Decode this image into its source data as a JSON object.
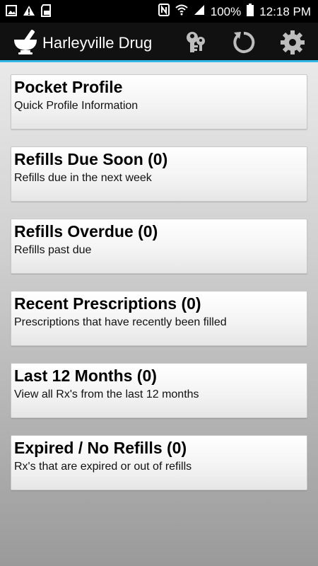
{
  "status_bar": {
    "left_icons": [
      "image-icon",
      "warning-icon",
      "sd-card-icon"
    ],
    "right_icons": [
      "nfc-icon",
      "wifi-icon",
      "signal-icon",
      "battery-icon"
    ],
    "battery": "100%",
    "time": "12:18 PM"
  },
  "app_bar": {
    "title": "Harleyville Drug",
    "logo_icon": "mortar-pestle-icon",
    "actions": [
      "unlock-keys-icon",
      "refresh-icon",
      "settings-gear-icon"
    ],
    "accent_color": "#33b5e5"
  },
  "cards": [
    {
      "title": "Pocket Profile",
      "subtitle": "Quick Profile Information"
    },
    {
      "title": "Refills Due Soon (0)",
      "subtitle": "Refills due in the next week"
    },
    {
      "title": "Refills Overdue (0)",
      "subtitle": "Refills past due"
    },
    {
      "title": "Recent Prescriptions (0)",
      "subtitle": "Prescriptions that have recently been filled"
    },
    {
      "title": "Last 12 Months (0)",
      "subtitle": "View all Rx's from the last 12 months"
    },
    {
      "title": "Expired / No Refills (0)",
      "subtitle": "Rx's that are expired or out of refills"
    }
  ]
}
